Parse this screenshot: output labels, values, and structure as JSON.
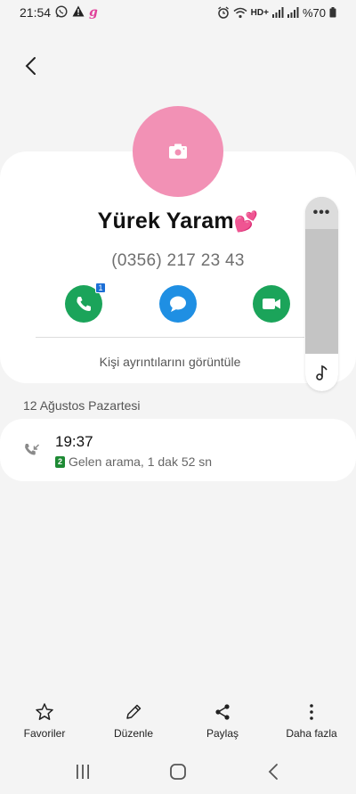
{
  "status_bar": {
    "time": "21:54",
    "battery_text": "%70",
    "network_badge": "HD+"
  },
  "contact": {
    "name": "Yürek Yaram",
    "name_emoji": "💕",
    "phone": "(0356) 217 23 43",
    "avatar_color": "#f291b5",
    "call_badge": "1",
    "view_details": "Kişi ayrıntılarını görüntüle"
  },
  "edge_panel": {
    "menu_glyph": "•••",
    "music_glyph": "♪"
  },
  "call_log": {
    "date": "12 Ağustos Pazartesi",
    "entries": [
      {
        "time": "19:37",
        "sim": "2",
        "detail": "Gelen arama, 1 dak 52 sn"
      }
    ]
  },
  "toolbar": {
    "favorites": "Favoriler",
    "edit": "Düzenle",
    "share": "Paylaş",
    "more": "Daha fazla"
  },
  "colors": {
    "accent_green": "#1ba45a",
    "accent_blue": "#1f8fe3",
    "sim_green": "#1e8a34"
  }
}
